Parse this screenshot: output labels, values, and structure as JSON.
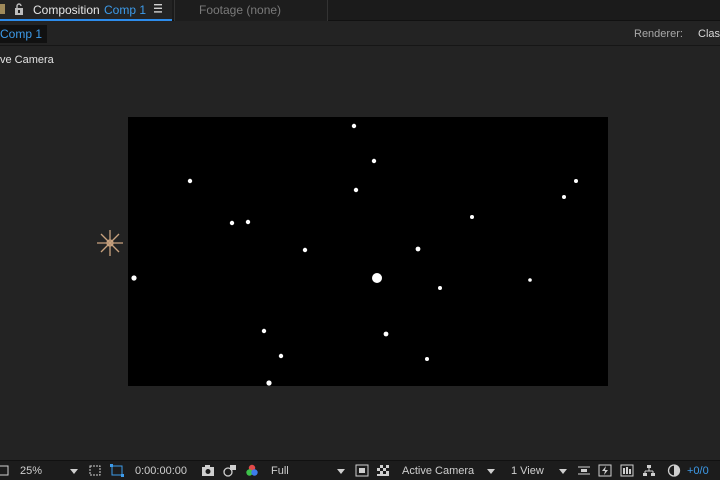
{
  "tabs": {
    "composition_label": "Composition",
    "composition_name": "Comp 1",
    "footage_label": "Footage (none)"
  },
  "subbar": {
    "comp_chip": "Comp 1",
    "renderer_label": "Renderer:",
    "renderer_value": "Clas"
  },
  "viewer": {
    "camera_label": "ve Camera"
  },
  "bottom": {
    "magnification": "25%",
    "timecode": "0:00:00:00",
    "resolution": "Full",
    "view": "Active Camera",
    "view_layout": "1 View",
    "exposure": "+0/0"
  },
  "colors": {
    "accent": "#3d9bea",
    "background": "#232323",
    "frame": "#000000",
    "light_icon": "#c9a27e"
  },
  "icons": [
    "lock-icon",
    "panel-menu-icon",
    "light-icon",
    "region-of-interest-icon",
    "toggle-transparency-grid-icon",
    "snapshot-icon",
    "show-snapshot-icon",
    "color-channels-icon",
    "fast-previews-icon",
    "timeline-icon",
    "flowchart-icon",
    "exposure-icon"
  ]
}
